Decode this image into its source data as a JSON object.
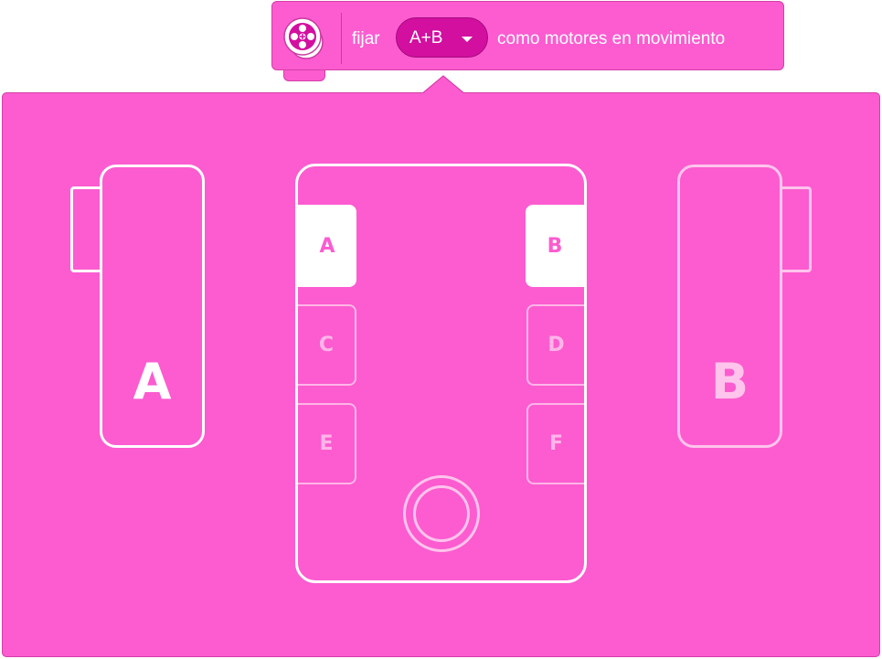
{
  "block": {
    "icon": "motor-wheel-icon",
    "prefix": "fijar",
    "dropdown_value": "A+B",
    "dropdown_caret_icon": "chevron-down-icon",
    "suffix": "como motores en movimiento",
    "color": "#fc5cd0"
  },
  "motors": {
    "left": {
      "label": "A",
      "state": "selected"
    },
    "right": {
      "label": "B",
      "state": "selected-dimmed"
    }
  },
  "hub": {
    "ports_left": [
      {
        "label": "A",
        "active": true
      },
      {
        "label": "C",
        "active": false
      },
      {
        "label": "E",
        "active": false
      }
    ],
    "ports_right": [
      {
        "label": "B",
        "active": true
      },
      {
        "label": "D",
        "active": false
      },
      {
        "label": "F",
        "active": false
      }
    ],
    "center_button_icon": "hub-button-icon"
  },
  "colors": {
    "panel": "#fc5cd0",
    "active_port": "#ffffff",
    "inactive": "#ffb5e8",
    "dropdown": "#d30fa0"
  }
}
